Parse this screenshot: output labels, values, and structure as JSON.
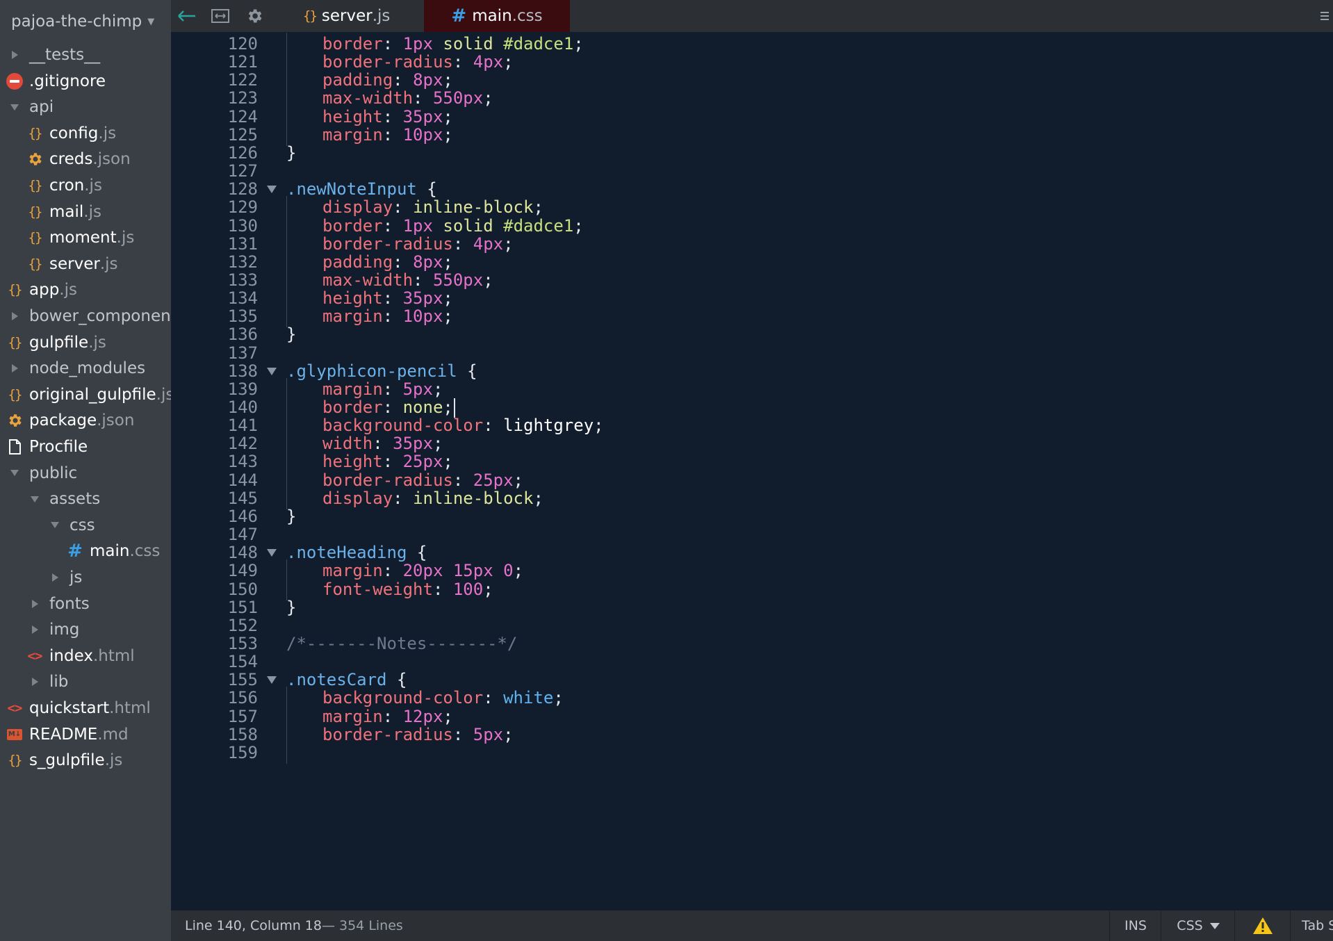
{
  "project": {
    "name": "pajoa-the-chimp"
  },
  "tree": [
    {
      "kind": "folder-closed",
      "icon": "folder-collapsed-icon",
      "depth": 0,
      "name": "__tests__",
      "ext": ""
    },
    {
      "kind": "file",
      "icon": "no-entry-icon",
      "depth": 0,
      "name": ".gitignore",
      "ext": ""
    },
    {
      "kind": "folder-open",
      "icon": "folder-expanded-icon",
      "depth": 0,
      "name": "api",
      "ext": ""
    },
    {
      "kind": "file",
      "icon": "braces-icon",
      "depth": 1,
      "name": "config",
      "ext": ".js"
    },
    {
      "kind": "file",
      "icon": "gear-icon",
      "depth": 1,
      "name": "creds",
      "ext": ".json"
    },
    {
      "kind": "file",
      "icon": "braces-icon",
      "depth": 1,
      "name": "cron",
      "ext": ".js"
    },
    {
      "kind": "file",
      "icon": "braces-icon",
      "depth": 1,
      "name": "mail",
      "ext": ".js"
    },
    {
      "kind": "file",
      "icon": "braces-icon",
      "depth": 1,
      "name": "moment",
      "ext": ".js"
    },
    {
      "kind": "file",
      "icon": "braces-icon",
      "depth": 1,
      "name": "server",
      "ext": ".js"
    },
    {
      "kind": "file",
      "icon": "braces-icon",
      "depth": 0,
      "name": "app",
      "ext": ".js"
    },
    {
      "kind": "folder-closed",
      "icon": "folder-collapsed-icon",
      "depth": 0,
      "name": "bower_componen",
      "ext": ""
    },
    {
      "kind": "file",
      "icon": "braces-icon",
      "depth": 0,
      "name": "gulpfile",
      "ext": ".js"
    },
    {
      "kind": "folder-closed",
      "icon": "folder-collapsed-icon",
      "depth": 0,
      "name": "node_modules",
      "ext": ""
    },
    {
      "kind": "file",
      "icon": "braces-icon",
      "depth": 0,
      "name": "original_gulpfile",
      "ext": ".js"
    },
    {
      "kind": "file",
      "icon": "gear-icon",
      "depth": 0,
      "name": "package",
      "ext": ".json"
    },
    {
      "kind": "file",
      "icon": "document-icon",
      "depth": 0,
      "name": "Procfile",
      "ext": ""
    },
    {
      "kind": "folder-open",
      "icon": "folder-expanded-icon",
      "depth": 0,
      "name": "public",
      "ext": ""
    },
    {
      "kind": "folder-open",
      "icon": "folder-expanded-icon",
      "depth": 1,
      "name": "assets",
      "ext": ""
    },
    {
      "kind": "folder-open",
      "icon": "folder-expanded-icon",
      "depth": 2,
      "name": "css",
      "ext": ""
    },
    {
      "kind": "file",
      "icon": "hash-icon",
      "depth": 3,
      "name": "main",
      "ext": ".css"
    },
    {
      "kind": "folder-closed",
      "icon": "folder-collapsed-icon",
      "depth": 2,
      "name": "js",
      "ext": ""
    },
    {
      "kind": "folder-closed",
      "icon": "folder-collapsed-icon",
      "depth": 1,
      "name": "fonts",
      "ext": ""
    },
    {
      "kind": "folder-closed",
      "icon": "folder-collapsed-icon",
      "depth": 1,
      "name": "img",
      "ext": ""
    },
    {
      "kind": "file",
      "icon": "angle-brackets-icon",
      "depth": 1,
      "name": "index",
      "ext": ".html"
    },
    {
      "kind": "folder-closed",
      "icon": "folder-collapsed-icon",
      "depth": 1,
      "name": "lib",
      "ext": ""
    },
    {
      "kind": "file",
      "icon": "angle-brackets-icon",
      "depth": 0,
      "name": "quickstart",
      "ext": ".html"
    },
    {
      "kind": "file",
      "icon": "markdown-icon",
      "depth": 0,
      "name": "README",
      "ext": ".md"
    },
    {
      "kind": "file",
      "icon": "braces-icon",
      "depth": 0,
      "name": "s_gulpfile",
      "ext": ".js"
    }
  ],
  "toolbar": {
    "back_icon": "back-arrow-icon",
    "split_icon": "split-view-icon",
    "settings_icon": "gear-icon"
  },
  "tabs": [
    {
      "icon": "braces-icon",
      "name": "server",
      "ext": ".js",
      "active": false
    },
    {
      "icon": "hash-icon",
      "name": "main",
      "ext": ".css",
      "active": true
    }
  ],
  "editor": {
    "cursor_line": 140,
    "lines": [
      {
        "n": 120,
        "fold": false,
        "indent": true,
        "tokens": [
          [
            "prop",
            "border"
          ],
          [
            "punct",
            ": "
          ],
          [
            "num",
            "1px"
          ],
          [
            "punct",
            " "
          ],
          [
            "kw",
            "solid"
          ],
          [
            "punct",
            " "
          ],
          [
            "hex",
            "#dadce1"
          ],
          [
            "punct",
            ";"
          ]
        ]
      },
      {
        "n": 121,
        "fold": false,
        "indent": true,
        "tokens": [
          [
            "prop",
            "border-radius"
          ],
          [
            "punct",
            ": "
          ],
          [
            "num",
            "4px"
          ],
          [
            "punct",
            ";"
          ]
        ]
      },
      {
        "n": 122,
        "fold": false,
        "indent": true,
        "tokens": [
          [
            "prop",
            "padding"
          ],
          [
            "punct",
            ": "
          ],
          [
            "num",
            "8px"
          ],
          [
            "punct",
            ";"
          ]
        ]
      },
      {
        "n": 123,
        "fold": false,
        "indent": true,
        "tokens": [
          [
            "prop",
            "max-width"
          ],
          [
            "punct",
            ": "
          ],
          [
            "num",
            "550px"
          ],
          [
            "punct",
            ";"
          ]
        ]
      },
      {
        "n": 124,
        "fold": false,
        "indent": true,
        "tokens": [
          [
            "prop",
            "height"
          ],
          [
            "punct",
            ": "
          ],
          [
            "num",
            "35px"
          ],
          [
            "punct",
            ";"
          ]
        ]
      },
      {
        "n": 125,
        "fold": false,
        "indent": true,
        "tokens": [
          [
            "prop",
            "margin"
          ],
          [
            "punct",
            ": "
          ],
          [
            "num",
            "10px"
          ],
          [
            "punct",
            ";"
          ]
        ]
      },
      {
        "n": 126,
        "fold": false,
        "indent": false,
        "tokens": [
          [
            "punct",
            "}"
          ]
        ]
      },
      {
        "n": 127,
        "fold": false,
        "indent": false,
        "tokens": []
      },
      {
        "n": 128,
        "fold": true,
        "indent": false,
        "tokens": [
          [
            "sel",
            ".newNoteInput"
          ],
          [
            "punct",
            " {"
          ]
        ]
      },
      {
        "n": 129,
        "fold": false,
        "indent": true,
        "tokens": [
          [
            "prop",
            "display"
          ],
          [
            "punct",
            ": "
          ],
          [
            "kw",
            "inline-block"
          ],
          [
            "punct",
            ";"
          ]
        ]
      },
      {
        "n": 130,
        "fold": false,
        "indent": true,
        "tokens": [
          [
            "prop",
            "border"
          ],
          [
            "punct",
            ": "
          ],
          [
            "num",
            "1px"
          ],
          [
            "punct",
            " "
          ],
          [
            "kw",
            "solid"
          ],
          [
            "punct",
            " "
          ],
          [
            "hex",
            "#dadce1"
          ],
          [
            "punct",
            ";"
          ]
        ]
      },
      {
        "n": 131,
        "fold": false,
        "indent": true,
        "tokens": [
          [
            "prop",
            "border-radius"
          ],
          [
            "punct",
            ": "
          ],
          [
            "num",
            "4px"
          ],
          [
            "punct",
            ";"
          ]
        ]
      },
      {
        "n": 132,
        "fold": false,
        "indent": true,
        "tokens": [
          [
            "prop",
            "padding"
          ],
          [
            "punct",
            ": "
          ],
          [
            "num",
            "8px"
          ],
          [
            "punct",
            ";"
          ]
        ]
      },
      {
        "n": 133,
        "fold": false,
        "indent": true,
        "tokens": [
          [
            "prop",
            "max-width"
          ],
          [
            "punct",
            ": "
          ],
          [
            "num",
            "550px"
          ],
          [
            "punct",
            ";"
          ]
        ]
      },
      {
        "n": 134,
        "fold": false,
        "indent": true,
        "tokens": [
          [
            "prop",
            "height"
          ],
          [
            "punct",
            ": "
          ],
          [
            "num",
            "35px"
          ],
          [
            "punct",
            ";"
          ]
        ]
      },
      {
        "n": 135,
        "fold": false,
        "indent": true,
        "tokens": [
          [
            "prop",
            "margin"
          ],
          [
            "punct",
            ": "
          ],
          [
            "num",
            "10px"
          ],
          [
            "punct",
            ";"
          ]
        ]
      },
      {
        "n": 136,
        "fold": false,
        "indent": false,
        "tokens": [
          [
            "punct",
            "}"
          ]
        ]
      },
      {
        "n": 137,
        "fold": false,
        "indent": false,
        "tokens": []
      },
      {
        "n": 138,
        "fold": true,
        "indent": false,
        "tokens": [
          [
            "sel",
            ".glyphicon-pencil"
          ],
          [
            "punct",
            " {"
          ]
        ]
      },
      {
        "n": 139,
        "fold": false,
        "indent": true,
        "tokens": [
          [
            "prop",
            "margin"
          ],
          [
            "punct",
            ": "
          ],
          [
            "num",
            "5px"
          ],
          [
            "punct",
            ";"
          ]
        ]
      },
      {
        "n": 140,
        "fold": false,
        "indent": true,
        "tokens": [
          [
            "prop",
            "border"
          ],
          [
            "punct",
            ": "
          ],
          [
            "kw",
            "none"
          ],
          [
            "punct",
            ";"
          ]
        ]
      },
      {
        "n": 141,
        "fold": false,
        "indent": true,
        "tokens": [
          [
            "prop",
            "background-color"
          ],
          [
            "punct",
            ": "
          ],
          [
            "ident",
            "lightgrey"
          ],
          [
            "punct",
            ";"
          ]
        ]
      },
      {
        "n": 142,
        "fold": false,
        "indent": true,
        "tokens": [
          [
            "prop",
            "width"
          ],
          [
            "punct",
            ": "
          ],
          [
            "num",
            "35px"
          ],
          [
            "punct",
            ";"
          ]
        ]
      },
      {
        "n": 143,
        "fold": false,
        "indent": true,
        "tokens": [
          [
            "prop",
            "height"
          ],
          [
            "punct",
            ": "
          ],
          [
            "num",
            "25px"
          ],
          [
            "punct",
            ";"
          ]
        ]
      },
      {
        "n": 144,
        "fold": false,
        "indent": true,
        "tokens": [
          [
            "prop",
            "border-radius"
          ],
          [
            "punct",
            ": "
          ],
          [
            "num",
            "25px"
          ],
          [
            "punct",
            ";"
          ]
        ]
      },
      {
        "n": 145,
        "fold": false,
        "indent": true,
        "tokens": [
          [
            "prop",
            "display"
          ],
          [
            "punct",
            ": "
          ],
          [
            "kw",
            "inline-block"
          ],
          [
            "punct",
            ";"
          ]
        ]
      },
      {
        "n": 146,
        "fold": false,
        "indent": false,
        "tokens": [
          [
            "punct",
            "}"
          ]
        ]
      },
      {
        "n": 147,
        "fold": false,
        "indent": false,
        "tokens": []
      },
      {
        "n": 148,
        "fold": true,
        "indent": false,
        "tokens": [
          [
            "sel",
            ".noteHeading"
          ],
          [
            "punct",
            " {"
          ]
        ]
      },
      {
        "n": 149,
        "fold": false,
        "indent": true,
        "tokens": [
          [
            "prop",
            "margin"
          ],
          [
            "punct",
            ": "
          ],
          [
            "num",
            "20px"
          ],
          [
            "punct",
            " "
          ],
          [
            "num",
            "15px"
          ],
          [
            "punct",
            " "
          ],
          [
            "num",
            "0"
          ],
          [
            "punct",
            ";"
          ]
        ]
      },
      {
        "n": 150,
        "fold": false,
        "indent": true,
        "tokens": [
          [
            "prop",
            "font-weight"
          ],
          [
            "punct",
            ": "
          ],
          [
            "num",
            "100"
          ],
          [
            "punct",
            ";"
          ]
        ]
      },
      {
        "n": 151,
        "fold": false,
        "indent": false,
        "tokens": [
          [
            "punct",
            "}"
          ]
        ]
      },
      {
        "n": 152,
        "fold": false,
        "indent": false,
        "tokens": []
      },
      {
        "n": 153,
        "fold": false,
        "indent": false,
        "tokens": [
          [
            "cmt",
            "/*-------Notes-------*/"
          ]
        ]
      },
      {
        "n": 154,
        "fold": false,
        "indent": false,
        "tokens": []
      },
      {
        "n": 155,
        "fold": true,
        "indent": false,
        "tokens": [
          [
            "sel",
            ".notesCard"
          ],
          [
            "punct",
            " {"
          ]
        ]
      },
      {
        "n": 156,
        "fold": false,
        "indent": true,
        "tokens": [
          [
            "prop",
            "background-color"
          ],
          [
            "punct",
            ": "
          ],
          [
            "named",
            "white"
          ],
          [
            "punct",
            ";"
          ]
        ]
      },
      {
        "n": 157,
        "fold": false,
        "indent": true,
        "tokens": [
          [
            "prop",
            "margin"
          ],
          [
            "punct",
            ": "
          ],
          [
            "num",
            "12px"
          ],
          [
            "punct",
            ";"
          ]
        ]
      },
      {
        "n": 158,
        "fold": false,
        "indent": true,
        "tokens": [
          [
            "prop",
            "border-radius"
          ],
          [
            "punct",
            ": "
          ],
          [
            "num",
            "5px"
          ],
          [
            "punct",
            ";"
          ]
        ]
      },
      {
        "n": 159,
        "fold": false,
        "indent": true,
        "tokens": []
      }
    ]
  },
  "status": {
    "position": "Line 140, Column 18",
    "line_count": " — 354 Lines",
    "mode": "INS",
    "language": "CSS",
    "warning_icon": "warning-icon",
    "tab_size": "Tab Si"
  },
  "colors": {
    "sidebar_bg": "#3a3e45",
    "editor_bg": "#111c2c",
    "active_tab_bg": "#3a0b0f",
    "selector": "#6bb2ea",
    "property": "#f0727c",
    "number": "#e772c9",
    "keyword": "#dde69a",
    "comment": "#6d7a8c"
  }
}
